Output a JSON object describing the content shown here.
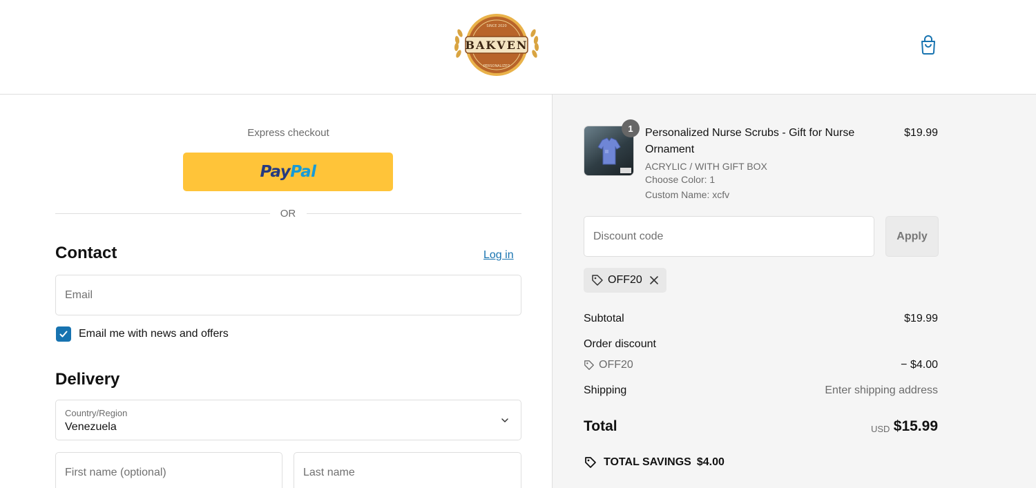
{
  "header": {
    "brand_top": "SINCE 2020",
    "brand_name": "BAKVEN",
    "brand_bottom": "PERSONALIZED"
  },
  "express": {
    "label": "Express checkout",
    "paypal_a": "Pay",
    "paypal_b": "Pal",
    "or_text": "OR"
  },
  "contact": {
    "heading": "Contact",
    "login_label": "Log in",
    "email_placeholder": "Email",
    "newsletter_label": "Email me with news and offers",
    "newsletter_checked": true
  },
  "delivery": {
    "heading": "Delivery",
    "country_label": "Country/Region",
    "country_value": "Venezuela",
    "first_name_placeholder": "First name (optional)",
    "last_name_placeholder": "Last name"
  },
  "order": {
    "item": {
      "quantity": "1",
      "name": "Personalized Nurse Scrubs - Gift for Nurse Ornament",
      "price": "$19.99",
      "variant": "ACRYLIC / WITH GIFT BOX",
      "color": "Choose Color: 1",
      "custom_name": "Custom Name: xcfv"
    },
    "discount_placeholder": "Discount code",
    "apply_label": "Apply",
    "applied_code": "OFF20",
    "subtotal_label": "Subtotal",
    "subtotal_value": "$19.99",
    "order_discount_label": "Order discount",
    "discount_code": "OFF20",
    "discount_value": "− $4.00",
    "shipping_label": "Shipping",
    "shipping_value": "Enter shipping address",
    "total_label": "Total",
    "total_currency": "USD",
    "total_value": "$15.99",
    "savings_label": "TOTAL SAVINGS",
    "savings_value": "$4.00"
  },
  "colors": {
    "accent": "#1773b0",
    "paypal_yellow": "#ffc439",
    "summary_bg": "#f5f5f5"
  }
}
